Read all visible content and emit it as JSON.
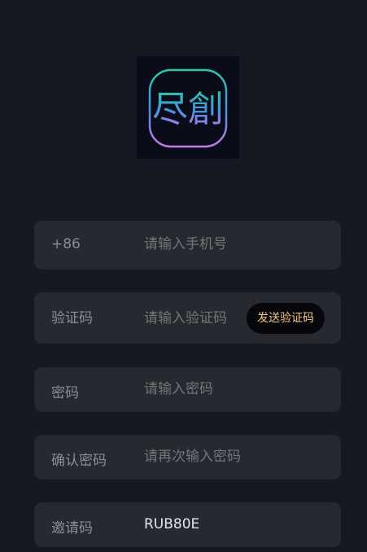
{
  "logo": {
    "text": "尽創",
    "gradient_start": "#2fc7a3",
    "gradient_mid": "#4a8fe0",
    "gradient_end": "#c27be6"
  },
  "form": {
    "phone": {
      "label": "+86",
      "placeholder": "请输入手机号"
    },
    "code": {
      "label": "验证码",
      "placeholder": "请输入验证码",
      "send_button": "发送验证码"
    },
    "password": {
      "label": "密码",
      "placeholder": "请输入密码"
    },
    "confirm": {
      "label": "确认密码",
      "placeholder": "请再次输入密码"
    },
    "invite": {
      "label": "邀请码",
      "value": "RUB80E"
    }
  },
  "colors": {
    "background": "#161922",
    "field_background": "#262930",
    "accent_text": "#f0c58a"
  }
}
